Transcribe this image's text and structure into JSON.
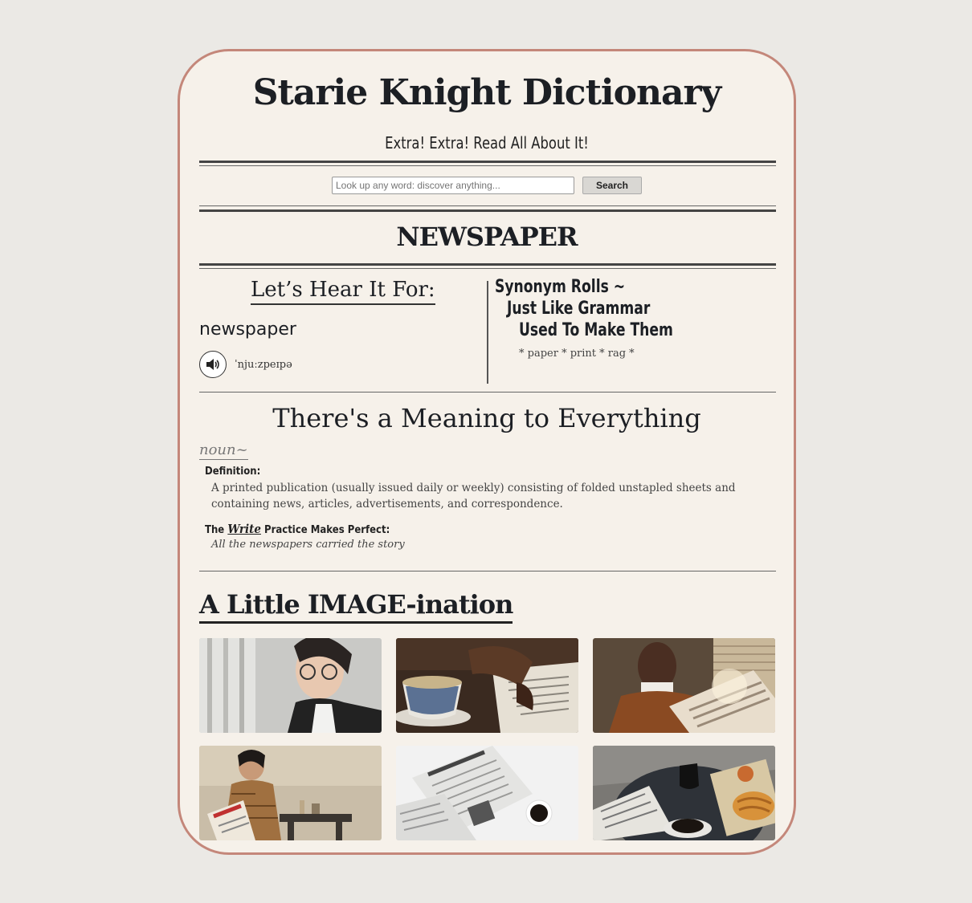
{
  "header": {
    "title": "Starie Knight Dictionary",
    "subtitle": "Extra! Extra! Read All About It!"
  },
  "search": {
    "placeholder": "Look up any word: discover anything...",
    "button_label": "Search"
  },
  "entry": {
    "headword": "NEWSPAPER",
    "lets_hear": "Let’s Hear It For:",
    "word": "newspaper",
    "phonetic": "ˈnjuːzpeɪpə",
    "audio_icon": "speaker-icon"
  },
  "synonyms": {
    "line1": "Synonym Rolls ~",
    "line2": "Just Like Grammar",
    "line3": "Used To Make Them",
    "list": "* paper * print * rag *"
  },
  "meanings": {
    "title": "There's a Meaning to Everything",
    "part_of_speech": "noun~",
    "definition_label": "Definition:",
    "definition": "A printed publication (usually issued daily or weekly) consisting of folded unstapled sheets and containing news, articles, advertisements, and correspondence.",
    "practice_prefix": "The",
    "practice_word": "Write",
    "practice_suffix": "Practice Makes Perfect:",
    "example": "All the newspapers carried the story"
  },
  "gallery": {
    "title": "A Little IMAGE-ination",
    "images": [
      "woman-with-glasses-photo",
      "teacup-and-newspaper-photo",
      "man-reading-newspaper-photo",
      "person-holding-newspaper-photo",
      "new-york-times-papers-photo",
      "breakfast-with-newspaper-photo"
    ]
  },
  "colors": {
    "background": "#ebe9e5",
    "card": "#f6f1ea",
    "card_border": "#c4877a",
    "ink": "#1c1f24"
  }
}
